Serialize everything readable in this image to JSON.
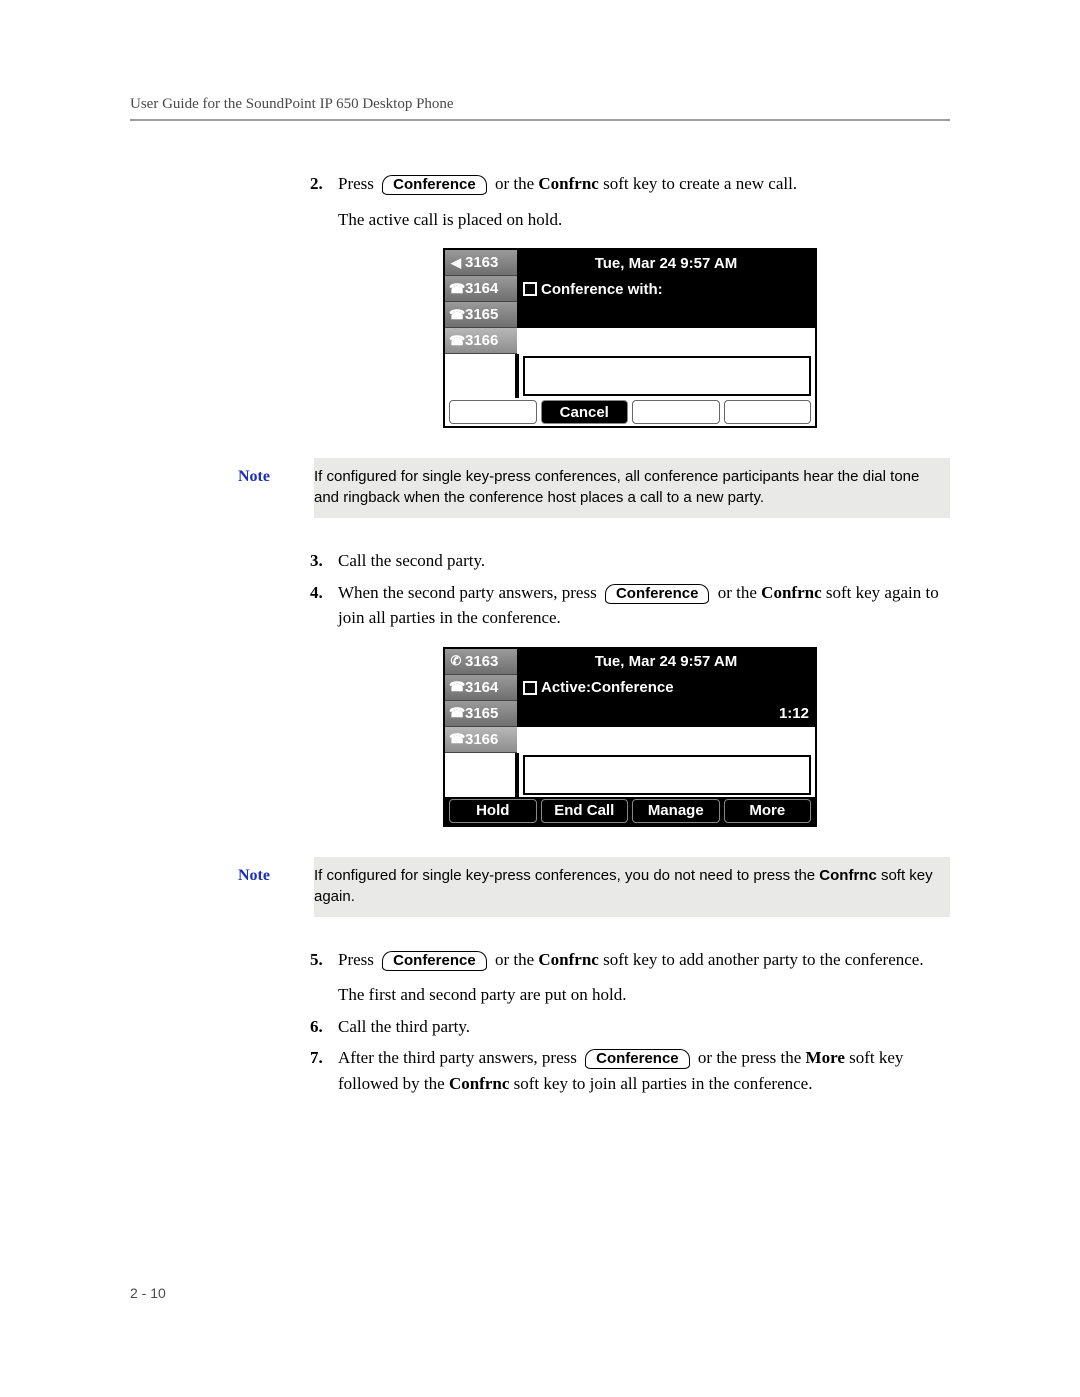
{
  "header_title": "User Guide for the SoundPoint IP 650 Desktop Phone",
  "page_number": "2 - 10",
  "btn_conference": "Conference",
  "note_label": "Note",
  "steps": {
    "s2": {
      "num": "2.",
      "pre": "Press ",
      "post_a": " or the ",
      "post_b": " soft key to create a new call.",
      "softkey": "Confrnc",
      "sub": "The active call is placed on hold."
    },
    "s3": {
      "num": "3.",
      "text": "Call the second party."
    },
    "s4": {
      "num": "4.",
      "pre": "When the second party answers, press ",
      "post_a": " or the ",
      "post_b": " soft key again to join all parties in the conference.",
      "softkey": "Confrnc"
    },
    "s5": {
      "num": "5.",
      "pre": "Press ",
      "post_a": " or the ",
      "post_b": " soft key to add another party to the conference.",
      "softkey": "Confrnc",
      "sub": "The first and second party are put on hold."
    },
    "s6": {
      "num": "6.",
      "text": "Call the third party."
    },
    "s7": {
      "num": "7.",
      "pre": "After the third party answers, press ",
      "post_a": " or the press the ",
      "post_b": " soft key followed by the ",
      "post_c": " soft key to join all parties in the conference.",
      "more": "More",
      "confrnc": "Confrnc"
    }
  },
  "note1": "If configured for single key-press conferences, all conference participants hear the dial tone and ringback when the conference host places a call to a new party.",
  "note2_a": "If configured for single key-press conferences, you do not need to press the ",
  "note2_b": " soft key again.",
  "note2_key": "Confrnc",
  "phone1": {
    "time": "Tue, Mar 24  9:57 AM",
    "lines": [
      "3163",
      "3164",
      "3165",
      "3166"
    ],
    "title": "Conference with:",
    "softkeys": [
      "Cancel"
    ]
  },
  "phone2": {
    "time": "Tue, Mar 24  9:57 AM",
    "lines": [
      "3163",
      "3164",
      "3165",
      "3166"
    ],
    "title": "Active:Conference",
    "timer": "1:12",
    "softkeys": [
      "Hold",
      "End Call",
      "Manage",
      "More"
    ]
  }
}
